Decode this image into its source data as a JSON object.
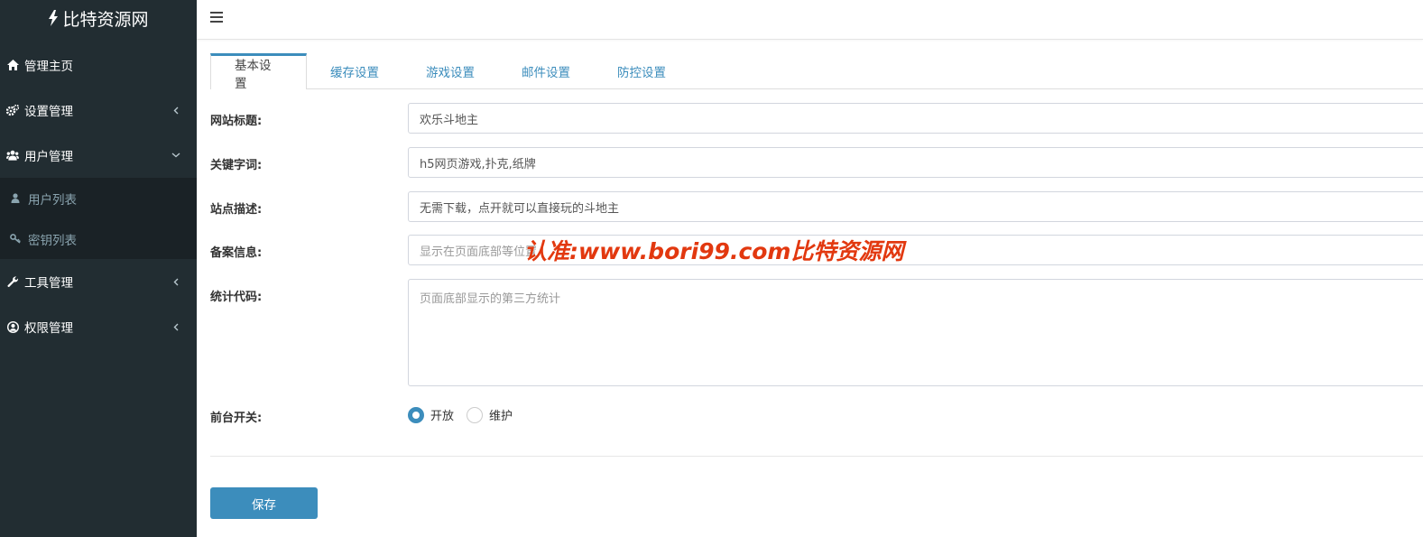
{
  "sidebar": {
    "brand": "比特资源网",
    "items": [
      {
        "label": "管理主页",
        "icon": "home-icon"
      },
      {
        "label": "设置管理",
        "icon": "gears-icon"
      },
      {
        "label": "用户管理",
        "icon": "users-icon"
      },
      {
        "label": "工具管理",
        "icon": "wrench-icon"
      },
      {
        "label": "权限管理",
        "icon": "user-circle-icon"
      }
    ],
    "submenu": [
      {
        "label": "用户列表",
        "icon": "user-icon"
      },
      {
        "label": "密钥列表",
        "icon": "key-icon"
      }
    ]
  },
  "tabs": [
    "基本设置",
    "缓存设置",
    "游戏设置",
    "邮件设置",
    "防控设置"
  ],
  "form": {
    "site_title_label": "网站标题:",
    "site_title_value": "欢乐斗地主",
    "keywords_label": "关键字词:",
    "keywords_value": "h5网页游戏,扑克,纸牌",
    "description_label": "站点描述:",
    "description_value": "无需下载，点开就可以直接玩的斗地主",
    "icp_label": "备案信息:",
    "icp_placeholder": "显示在页面底部等位置",
    "stats_label": "统计代码:",
    "stats_placeholder": "页面底部显示的第三方统计",
    "switch_label": "前台开关:",
    "switch_options": [
      "开放",
      "维护"
    ],
    "switch_selected": "开放"
  },
  "save_label": "保存",
  "watermark": "认准:www.bori99.com比特资源网",
  "colors": {
    "sidebar_bg": "#222d32",
    "accent": "#3c8dbc",
    "watermark": "#e2380f"
  }
}
